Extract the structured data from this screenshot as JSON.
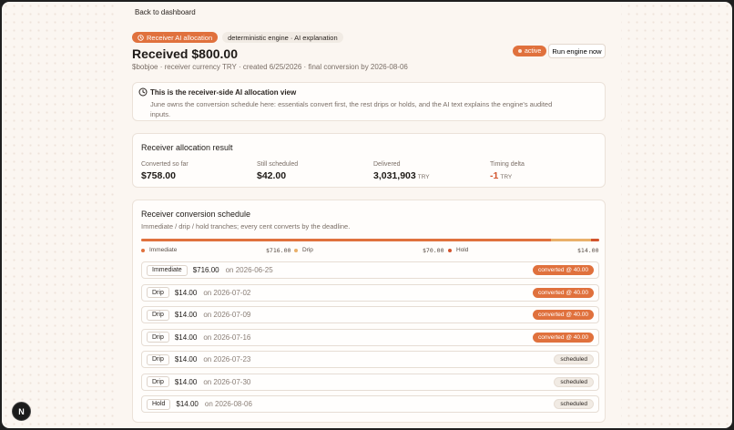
{
  "nav": {
    "back_label": "Back to dashboard"
  },
  "header": {
    "tag_primary": "Receiver AI allocation",
    "tag_secondary": "deterministic engine · AI explanation",
    "title": "Received $800.00",
    "subtitle": "$bobjoe · receiver currency TRY · created 6/25/2026 · final conversion by 2026-08-06",
    "status": "active",
    "run_label": "Run engine now"
  },
  "info": {
    "title": "This is the receiver-side AI allocation view",
    "body": "June owns the conversion schedule here: essentials convert first, the rest drips or holds, and the AI text explains the engine's audited inputs."
  },
  "allocation": {
    "title": "Receiver allocation result",
    "stats": [
      {
        "label": "Converted so far",
        "value": "$758.00",
        "unit": ""
      },
      {
        "label": "Still scheduled",
        "value": "$42.00",
        "unit": ""
      },
      {
        "label": "Delivered",
        "value": "3,031,903",
        "unit": "TRY"
      },
      {
        "label": "Timing delta",
        "value": "-1",
        "unit": "TRY"
      }
    ]
  },
  "schedule": {
    "title": "Receiver conversion schedule",
    "subtitle": "Immediate / drip / hold tranches; every cent converts by the deadline.",
    "bar_fractions": {
      "immediate": 0.895,
      "drip": 0.0875,
      "hold": 0.0175
    },
    "legend": [
      {
        "label": "Immediate",
        "value": "$716.00",
        "color": "#e0713d"
      },
      {
        "label": "Drip",
        "value": "$70.00",
        "color": "#e9b06a"
      },
      {
        "label": "Hold",
        "value": "$14.00",
        "color": "#d2542d"
      }
    ],
    "rows": [
      {
        "kind": "Immediate",
        "amount": "$716.00",
        "date": "on 2026-06-25",
        "status": "converted @ 40.00",
        "done": true
      },
      {
        "kind": "Drip",
        "amount": "$14.00",
        "date": "on 2026-07-02",
        "status": "converted @ 40.00",
        "done": true
      },
      {
        "kind": "Drip",
        "amount": "$14.00",
        "date": "on 2026-07-09",
        "status": "converted @ 40.00",
        "done": true
      },
      {
        "kind": "Drip",
        "amount": "$14.00",
        "date": "on 2026-07-16",
        "status": "converted @ 40.00",
        "done": true
      },
      {
        "kind": "Drip",
        "amount": "$14.00",
        "date": "on 2026-07-23",
        "status": "scheduled",
        "done": false
      },
      {
        "kind": "Drip",
        "amount": "$14.00",
        "date": "on 2026-07-30",
        "status": "scheduled",
        "done": false
      },
      {
        "kind": "Hold",
        "amount": "$14.00",
        "date": "on 2026-08-06",
        "status": "scheduled",
        "done": false
      }
    ]
  },
  "devtools": {
    "badge": "N"
  }
}
